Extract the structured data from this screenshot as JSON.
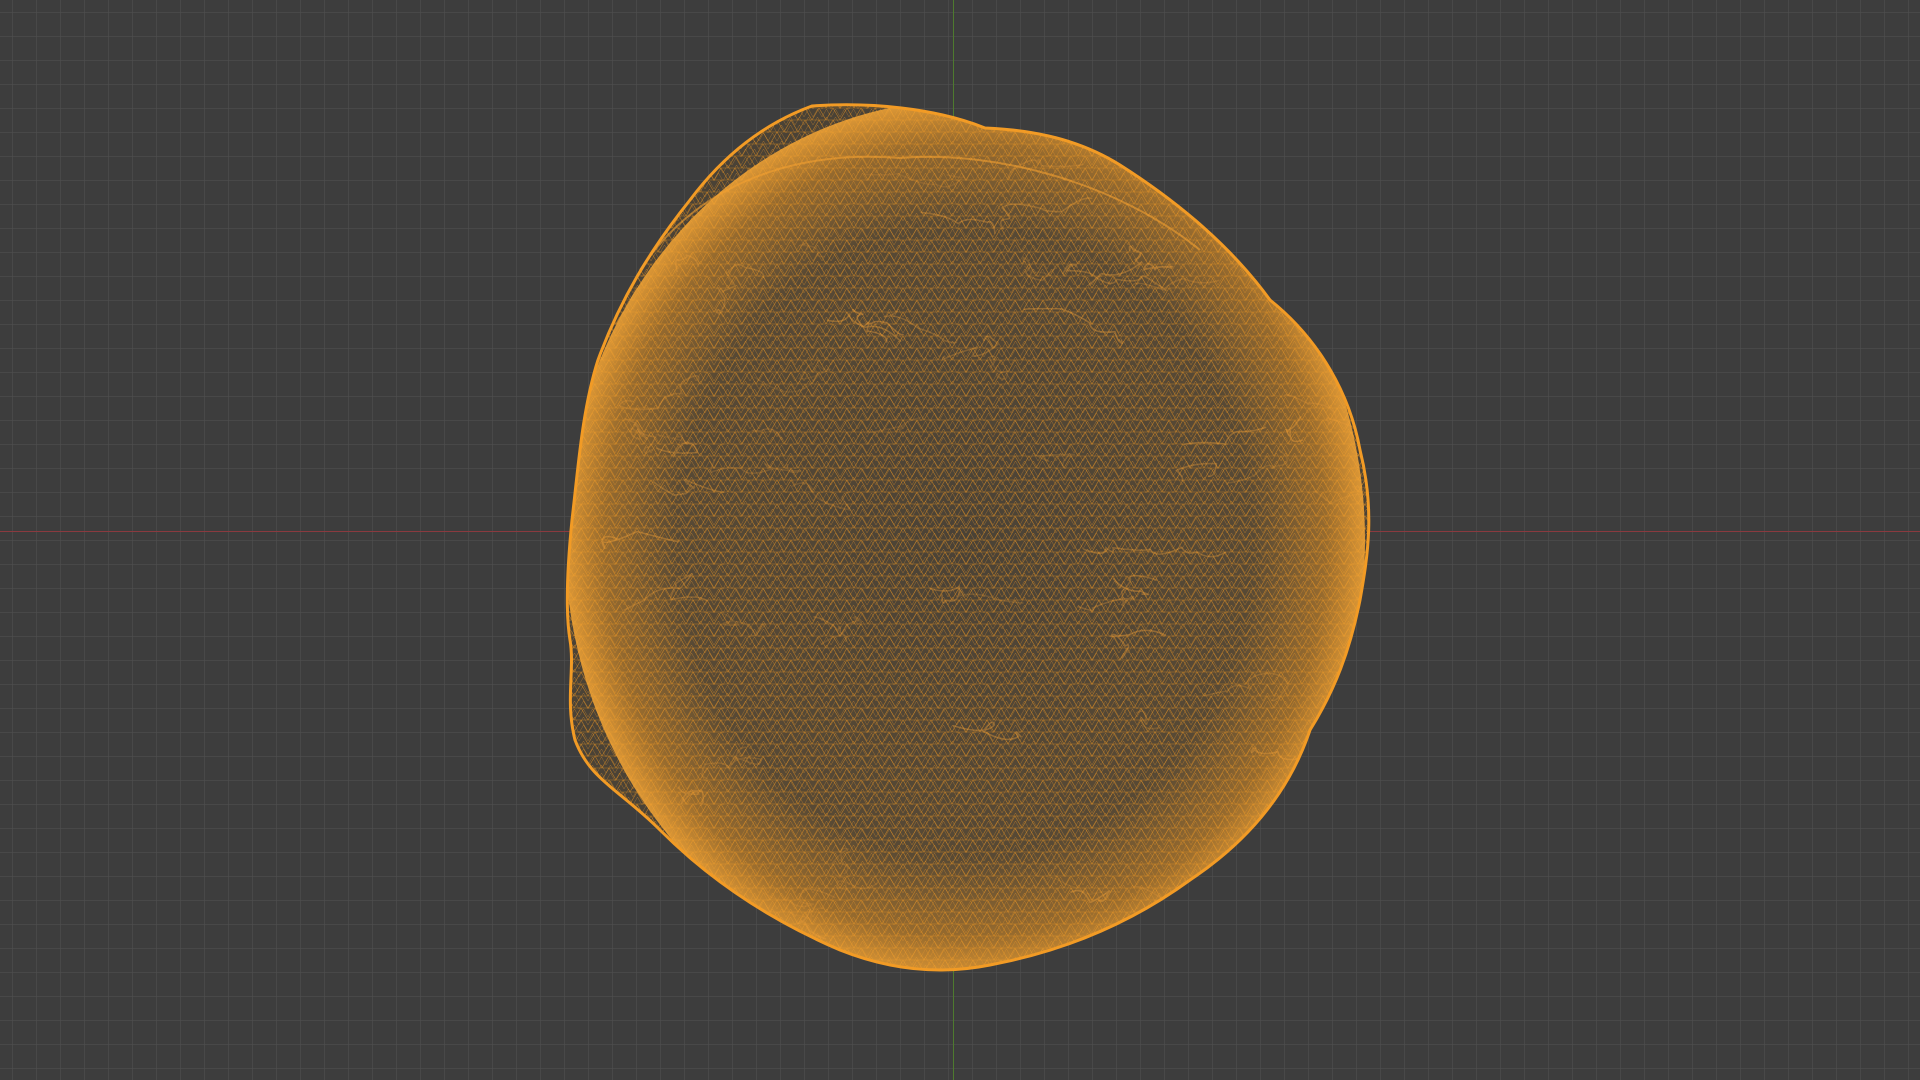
{
  "viewport": {
    "background_color": "#3d3d3d",
    "grid_color": "#4a4a4a",
    "x_axis_color": "#8a3a3f",
    "y_axis_color": "#4e7a2e",
    "view_mode": "wireframe"
  },
  "object": {
    "name": "",
    "selected": true,
    "shape": "irregular-sphere",
    "wire_color": "#f29b25",
    "wire_color_dark": "#c97b18"
  }
}
